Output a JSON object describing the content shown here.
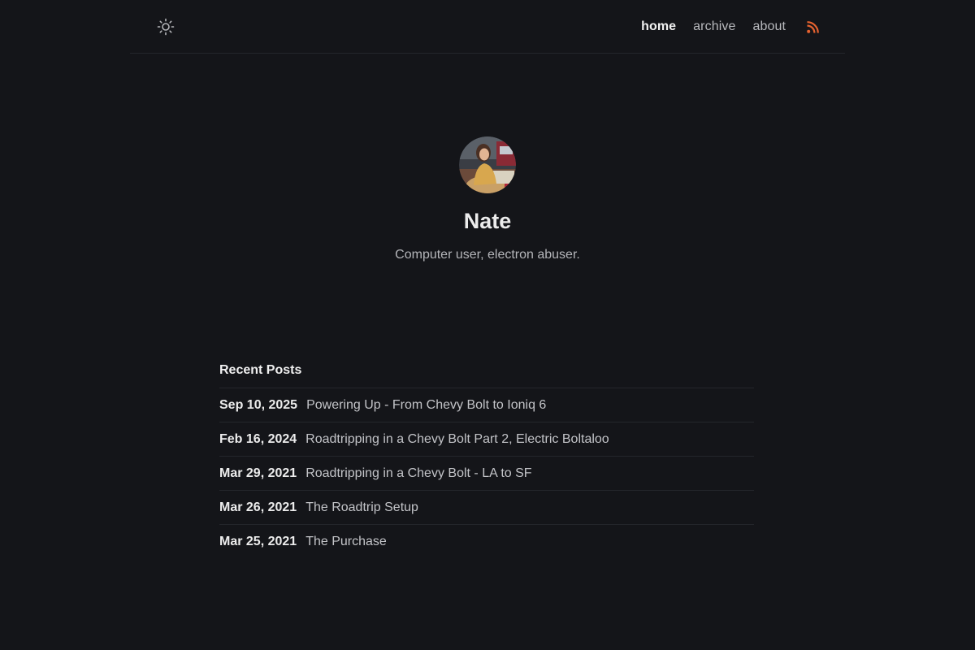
{
  "header": {
    "theme_toggle_icon": "sun-icon",
    "nav": [
      {
        "label": "home",
        "active": true
      },
      {
        "label": "archive",
        "active": false
      },
      {
        "label": "about",
        "active": false
      }
    ],
    "rss_icon": "rss-icon",
    "rss_color": "#e6622f"
  },
  "profile": {
    "name": "Nate",
    "bio": "Computer user, electron abuser."
  },
  "posts": {
    "title": "Recent Posts",
    "items": [
      {
        "date": "Sep 10, 2025",
        "title": "Powering Up - From Chevy Bolt to Ioniq 6"
      },
      {
        "date": "Feb 16, 2024",
        "title": "Roadtripping in a Chevy Bolt Part 2, Electric Boltaloo"
      },
      {
        "date": "Mar 29, 2021",
        "title": "Roadtripping in a Chevy Bolt - LA to SF"
      },
      {
        "date": "Mar 26, 2021",
        "title": "The Roadtrip Setup"
      },
      {
        "date": "Mar 25, 2021",
        "title": "The Purchase"
      }
    ]
  },
  "colors": {
    "background": "#141519",
    "text": "#e6e6e6",
    "muted": "#b8b9bd",
    "divider": "#24262b"
  }
}
